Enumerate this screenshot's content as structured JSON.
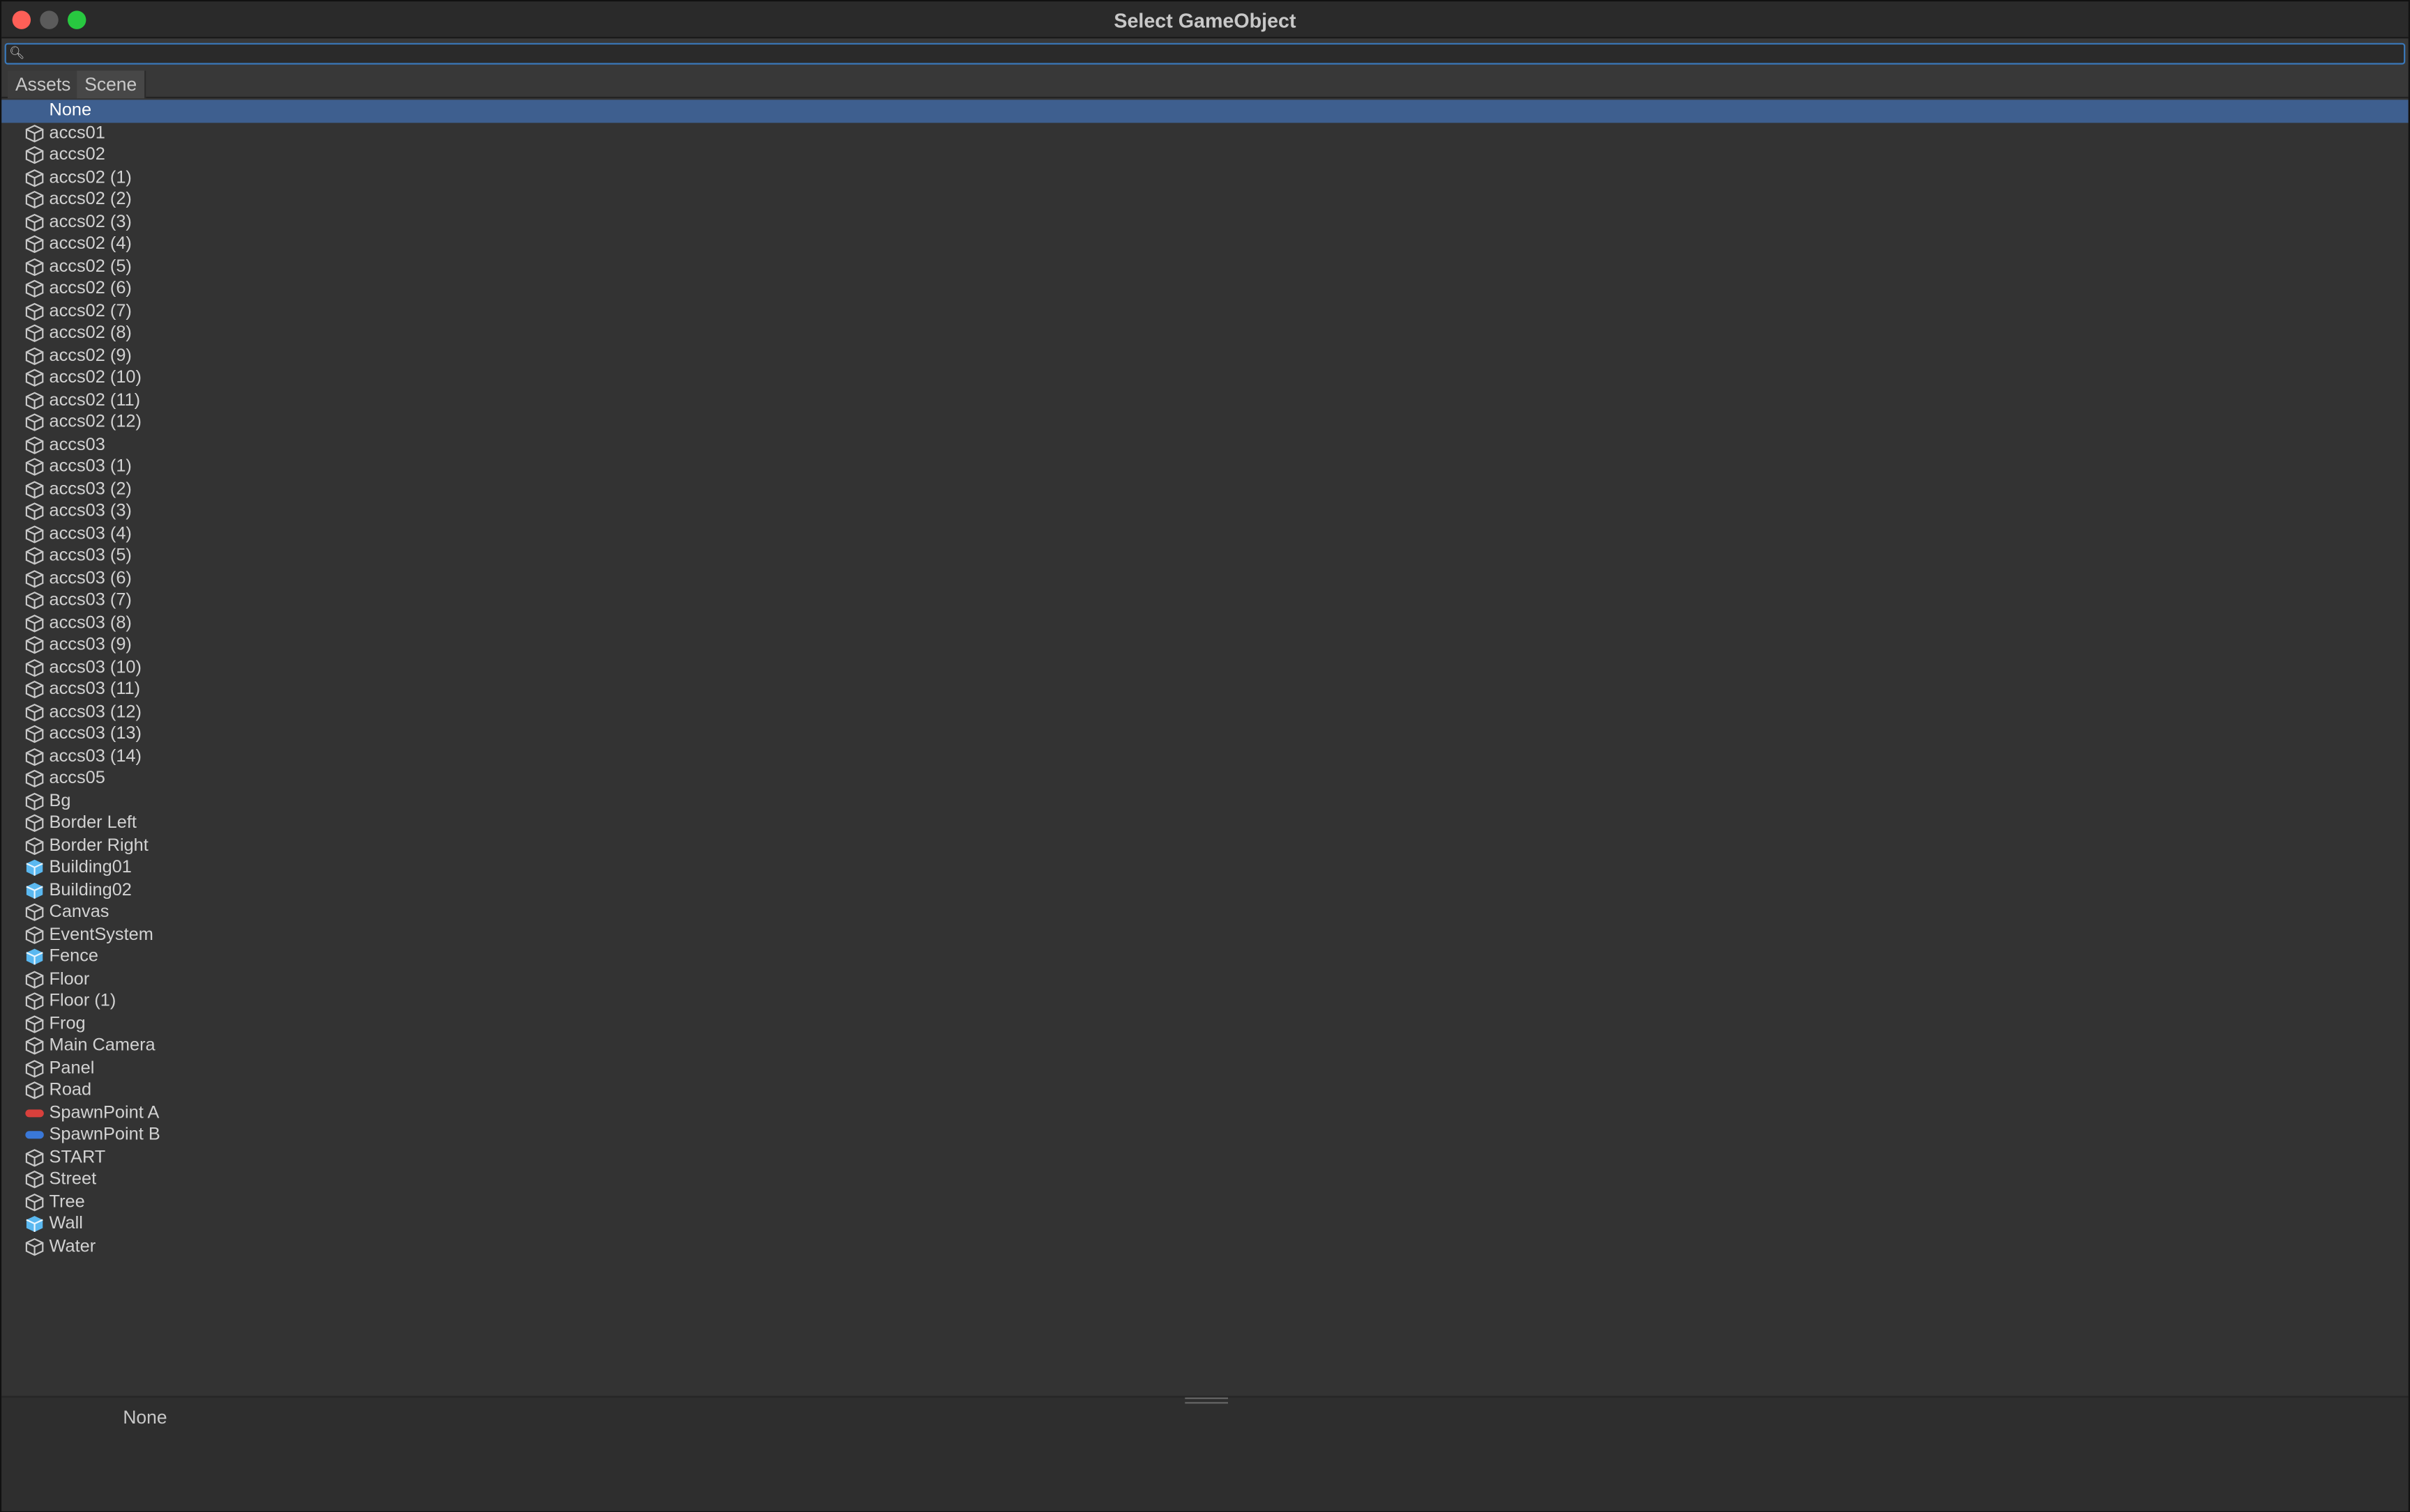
{
  "window": {
    "title": "Select GameObject"
  },
  "search": {
    "value": "",
    "placeholder": ""
  },
  "tabs": [
    "Assets",
    "Scene"
  ],
  "list": {
    "items": [
      {
        "label": "None",
        "icon": "none",
        "selected": true
      },
      {
        "label": "accs01",
        "icon": "gameobject-icon"
      },
      {
        "label": "accs02",
        "icon": "gameobject-icon"
      },
      {
        "label": "accs02 (1)",
        "icon": "gameobject-icon"
      },
      {
        "label": "accs02 (2)",
        "icon": "gameobject-icon"
      },
      {
        "label": "accs02 (3)",
        "icon": "gameobject-icon"
      },
      {
        "label": "accs02 (4)",
        "icon": "gameobject-icon"
      },
      {
        "label": "accs02 (5)",
        "icon": "gameobject-icon"
      },
      {
        "label": "accs02 (6)",
        "icon": "gameobject-icon"
      },
      {
        "label": "accs02 (7)",
        "icon": "gameobject-icon"
      },
      {
        "label": "accs02 (8)",
        "icon": "gameobject-icon"
      },
      {
        "label": "accs02 (9)",
        "icon": "gameobject-icon"
      },
      {
        "label": "accs02 (10)",
        "icon": "gameobject-icon"
      },
      {
        "label": "accs02 (11)",
        "icon": "gameobject-icon"
      },
      {
        "label": "accs02 (12)",
        "icon": "gameobject-icon"
      },
      {
        "label": "accs03",
        "icon": "gameobject-icon"
      },
      {
        "label": "accs03 (1)",
        "icon": "gameobject-icon"
      },
      {
        "label": "accs03 (2)",
        "icon": "gameobject-icon"
      },
      {
        "label": "accs03 (3)",
        "icon": "gameobject-icon"
      },
      {
        "label": "accs03 (4)",
        "icon": "gameobject-icon"
      },
      {
        "label": "accs03 (5)",
        "icon": "gameobject-icon"
      },
      {
        "label": "accs03 (6)",
        "icon": "gameobject-icon"
      },
      {
        "label": "accs03 (7)",
        "icon": "gameobject-icon"
      },
      {
        "label": "accs03 (8)",
        "icon": "gameobject-icon"
      },
      {
        "label": "accs03 (9)",
        "icon": "gameobject-icon"
      },
      {
        "label": "accs03 (10)",
        "icon": "gameobject-icon"
      },
      {
        "label": "accs03 (11)",
        "icon": "gameobject-icon"
      },
      {
        "label": "accs03 (12)",
        "icon": "gameobject-icon"
      },
      {
        "label": "accs03 (13)",
        "icon": "gameobject-icon"
      },
      {
        "label": "accs03 (14)",
        "icon": "gameobject-icon"
      },
      {
        "label": "accs05",
        "icon": "gameobject-icon"
      },
      {
        "label": "Bg",
        "icon": "gameobject-icon"
      },
      {
        "label": "Border Left",
        "icon": "gameobject-icon"
      },
      {
        "label": "Border Right",
        "icon": "gameobject-icon"
      },
      {
        "label": "Building01",
        "icon": "prefab-icon"
      },
      {
        "label": "Building02",
        "icon": "prefab-icon"
      },
      {
        "label": "Canvas",
        "icon": "gameobject-icon"
      },
      {
        "label": "EventSystem",
        "icon": "gameobject-icon"
      },
      {
        "label": "Fence",
        "icon": "prefab-icon"
      },
      {
        "label": "Floor",
        "icon": "gameobject-icon"
      },
      {
        "label": "Floor (1)",
        "icon": "gameobject-icon"
      },
      {
        "label": "Frog",
        "icon": "gameobject-icon"
      },
      {
        "label": "Main Camera",
        "icon": "gameobject-icon"
      },
      {
        "label": "Panel",
        "icon": "gameobject-icon"
      },
      {
        "label": "Road",
        "icon": "gameobject-icon"
      },
      {
        "label": "SpawnPoint A",
        "icon": "red-label-icon"
      },
      {
        "label": "SpawnPoint B",
        "icon": "blue-label-icon"
      },
      {
        "label": "START",
        "icon": "gameobject-icon"
      },
      {
        "label": "Street",
        "icon": "gameobject-icon"
      },
      {
        "label": "Tree",
        "icon": "gameobject-icon"
      },
      {
        "label": "Wall",
        "icon": "prefab-icon"
      },
      {
        "label": "Water",
        "icon": "gameobject-icon"
      }
    ]
  },
  "footer": {
    "selected_label": "None"
  },
  "colors": {
    "selection": "#3e5f8f",
    "prefab_blue": "#5ab8f0",
    "label_red": "#d8403c",
    "label_blue": "#3a78d8"
  }
}
